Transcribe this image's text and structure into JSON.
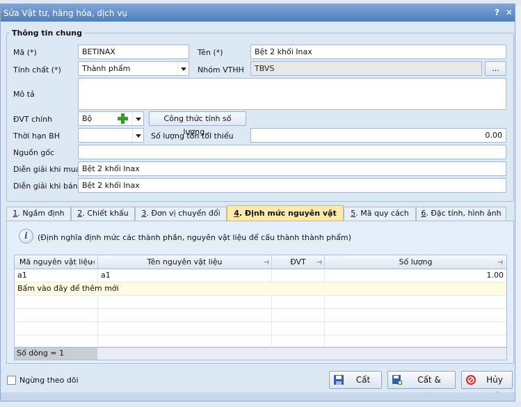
{
  "dialog": {
    "title": "Sửa Vật tư, hàng hóa, dịch vụ",
    "help_label": "?",
    "close_label": "✕"
  },
  "general": {
    "legend": "Thông tin chung",
    "ma_label": "Mã (*)",
    "ma_value": "BETINAX",
    "ten_label": "Tên (*)",
    "ten_value": "Bệt 2 khối Inax",
    "tinhchat_label": "Tính chất (*)",
    "tinhchat_value": "Thành phẩm",
    "nhom_label": "Nhóm VTHH",
    "nhom_value": "TBVS",
    "nhom_button": "...",
    "mota_label": "Mô tả",
    "mota_value": "",
    "dvt_label": "ĐVT chính",
    "dvt_value": "Bộ",
    "congthuc_button": "Công thức tính số lượng...",
    "thoihan_label": "Thời hạn BH",
    "thoihan_value": "",
    "soluongton_label": "Số lượng tồn tối thiểu",
    "soluongton_value": "0.00",
    "nguongoc_label": "Nguồn gốc",
    "nguongoc_value": "",
    "diengiaimua_label": "Diễn giải khi mua",
    "diengiaimua_value": "Bệt 2 khối Inax",
    "diengiaiban_label": "Diễn giải khi bán",
    "diengiaiban_value": "Bệt 2 khối Inax"
  },
  "tabs": [
    {
      "num": "1",
      "label": ". Ngầm định"
    },
    {
      "num": "2",
      "label": ". Chiết khấu"
    },
    {
      "num": "3",
      "label": ". Đơn vị chuyển đổi"
    },
    {
      "num": "4",
      "label": ". Định mức nguyên vật liệu"
    },
    {
      "num": "5",
      "label": ". Mã quy cách"
    },
    {
      "num": "6",
      "label": ". Đặc tính, hình ảnh"
    }
  ],
  "panel": {
    "info": "(Định nghĩa định mức các thành phần, nguyên vật liệu để cấu thành thành phẩm)"
  },
  "grid": {
    "columns": [
      "Mã nguyên vật liệu",
      "Tên nguyên vật liệu",
      "ĐVT",
      "Số lượng"
    ],
    "rows": [
      {
        "ma": "a1",
        "ten": "a1",
        "dvt": "",
        "soluong": "1.00"
      }
    ],
    "add_row": "Bấm vào đây để thêm mới",
    "footer": "Số dòng = 1"
  },
  "footer": {
    "ngung_label": "Ngừng theo dõi",
    "cat_label": "Cất",
    "catthem_label": "Cất & Thêm",
    "huybo_label": "Hủy bỏ"
  },
  "colors": {
    "title_bar": "#4f7fbf",
    "active_tab": "#fde9a8",
    "add_row": "#fffbe0",
    "cancel_icon": "#d12a2a",
    "plus_icon": "#3a9a2e"
  }
}
